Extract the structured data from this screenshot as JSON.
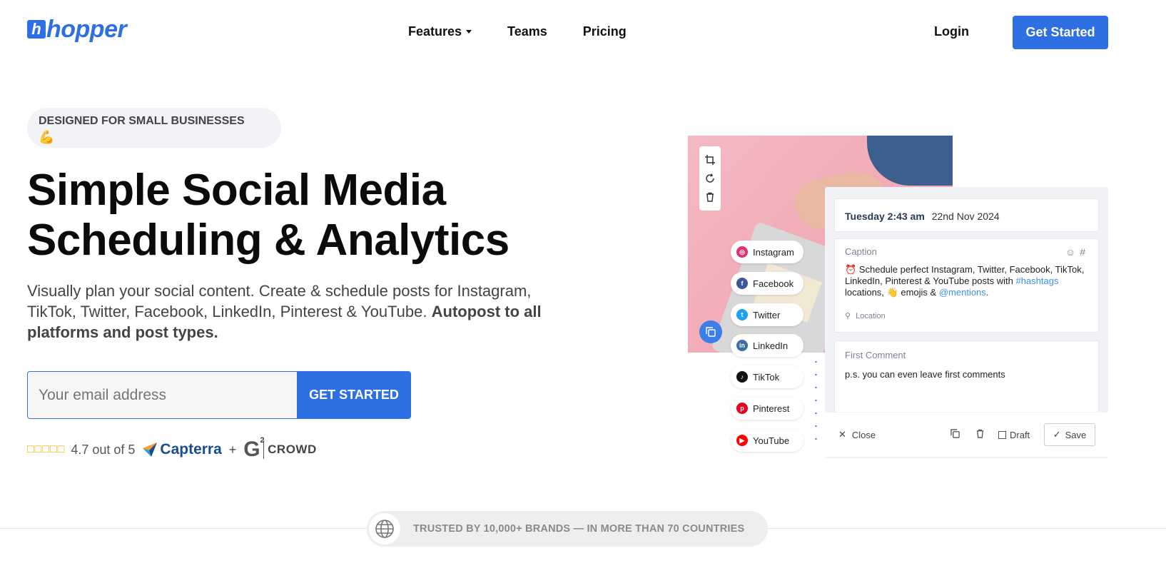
{
  "brand": {
    "mark": "h",
    "name": "hopper",
    "color": "#2f6fe4"
  },
  "nav": {
    "items": [
      {
        "label": "Features",
        "has_dropdown": true
      },
      {
        "label": "Teams",
        "has_dropdown": false
      },
      {
        "label": "Pricing",
        "has_dropdown": false
      }
    ],
    "login": "Login",
    "cta": "Get Started"
  },
  "hero": {
    "badge": "DESIGNED FOR SMALL BUSINESSES",
    "badge_emoji": "💪",
    "headline_line1": "Simple Social Media",
    "headline_line2": "Scheduling & Analytics",
    "sub_text": "Visually plan your social content. Create & schedule posts for Instagram, TikTok, Twitter, Facebook, LinkedIn, Pinterest & YouTube.",
    "sub_bold": "Autopost to all platforms and post types.",
    "email_placeholder": "Your email address",
    "email_cta": "GET STARTED",
    "stars": "□□□□□",
    "rating_text": "4.7 out of 5",
    "capterra": "Capterra",
    "plus": "+",
    "g2_mark": "G",
    "g2_super": "2",
    "crowd": "CROWD"
  },
  "trust": {
    "text": "TRUSTED BY 10,000+ BRANDS — IN MORE THAN 70 COUNTRIES"
  },
  "scheduler": {
    "platforms": [
      {
        "label": "Instagram",
        "icon": "instagram-icon",
        "color": "#e1306c"
      },
      {
        "label": "Facebook",
        "icon": "facebook-icon",
        "color": "#3b5998"
      },
      {
        "label": "Twitter",
        "icon": "twitter-icon",
        "color": "#1da1f2"
      },
      {
        "label": "LinkedIn",
        "icon": "linkedin-icon",
        "color": "#3a6ea5"
      },
      {
        "label": "TikTok",
        "icon": "tiktok-icon",
        "color": "#111111"
      },
      {
        "label": "Pinterest",
        "icon": "pinterest-icon",
        "color": "#e60023"
      },
      {
        "label": "YouTube",
        "icon": "youtube-icon",
        "color": "#ff0000"
      }
    ],
    "date_time": "Tuesday 2:43 am",
    "date": "22nd Nov 2024",
    "caption_label": "Caption",
    "caption_prefix_emoji": "⏰",
    "caption_text_1": "Schedule perfect Instagram, Twitter, Facebook, TikTok, LinkedIn, Pinterest & YouTube posts with",
    "caption_hashtags": "#hashtags",
    "caption_text_2": "locations,",
    "caption_wave": "👋",
    "caption_text_3": "emojis &",
    "caption_mentions": "@mentions",
    "caption_end": ".",
    "location_label": "Location",
    "first_comment_label": "First Comment",
    "first_comment_text": "p.s. you can even leave first comments",
    "close": "Close",
    "draft": "Draft",
    "save": "Save"
  }
}
